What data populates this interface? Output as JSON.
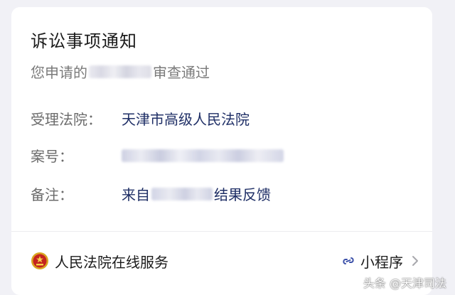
{
  "notice": {
    "title": "诉讼事项通知",
    "subtitle_prefix": "您申请的",
    "subtitle_suffix": "审查通过"
  },
  "fields": {
    "court_label": "受理法院：",
    "court_value": "天津市高级人民法院",
    "case_label": "案号：",
    "note_label": "备注：",
    "note_prefix": "来自",
    "note_suffix": "结果反馈"
  },
  "footer": {
    "service_name": "人民法院在线服务",
    "mini_program_label": "小程序"
  },
  "watermark": "头条 @天津司法",
  "icons": {
    "emblem": "court-emblem-icon",
    "link": "link-icon",
    "chevron": "chevron-right-icon"
  },
  "colors": {
    "background": "#f1f1f6",
    "card": "#ffffff",
    "value_text": "#1f2f66",
    "label_text": "#6b6b6b"
  }
}
